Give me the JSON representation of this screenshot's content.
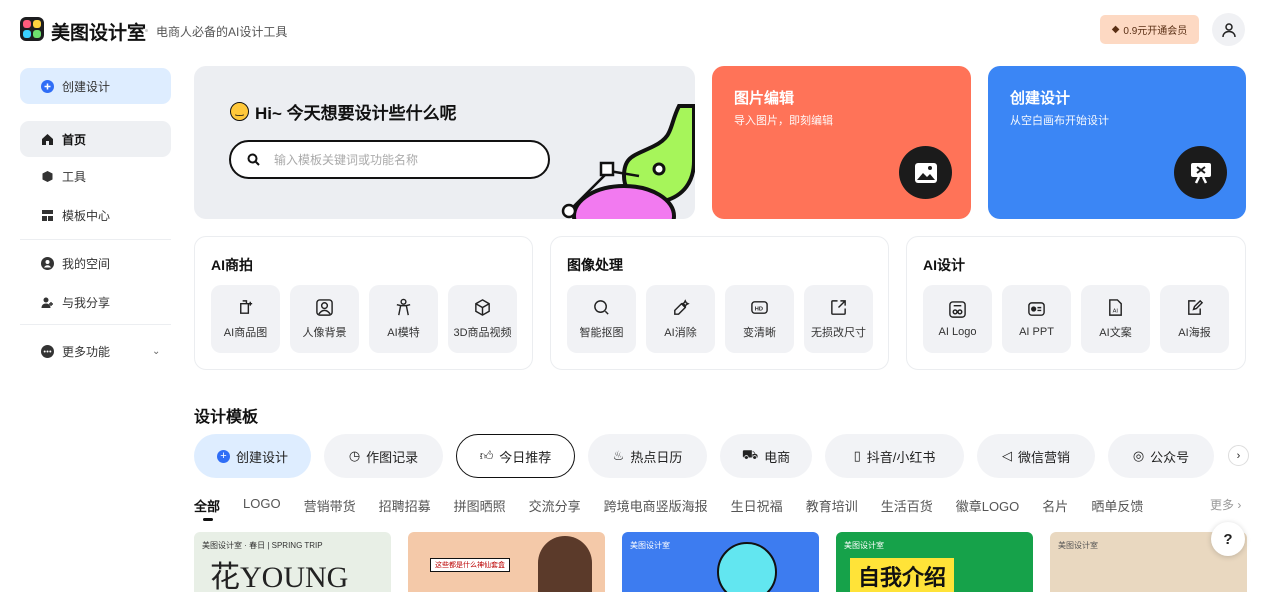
{
  "header": {
    "brand": "美图设计室",
    "slogan": "电商人必备的AI设计工具",
    "vip": "0.9元开通会员"
  },
  "sidebar": {
    "create": "创建设计",
    "items": [
      {
        "label": "首页"
      },
      {
        "label": "工具"
      },
      {
        "label": "模板中心"
      },
      {
        "label": "我的空间"
      },
      {
        "label": "与我分享"
      },
      {
        "label": "更多功能"
      }
    ]
  },
  "hero": {
    "greeting": "Hi~ 今天想要设计些什么呢",
    "placeholder": "输入模板关键词或功能名称"
  },
  "cards": [
    {
      "title": "图片编辑",
      "sub": "导入图片，即刻编辑",
      "color": "#ff7358"
    },
    {
      "title": "创建设计",
      "sub": "从空白画布开始设计",
      "color": "#3b86f5"
    }
  ],
  "groups": [
    {
      "title": "AI商拍",
      "tools": [
        "AI商品图",
        "人像背景",
        "AI模特",
        "3D商品视频"
      ]
    },
    {
      "title": "图像处理",
      "tools": [
        "智能抠图",
        "AI消除",
        "变清晰",
        "无损改尺寸"
      ]
    },
    {
      "title": "AI设计",
      "tools": [
        "AI Logo",
        "AI PPT",
        "AI文案",
        "AI海报"
      ]
    }
  ],
  "templates": {
    "title": "设计模板",
    "pills": [
      "创建设计",
      "作图记录",
      "今日推荐",
      "热点日历",
      "电商",
      "抖音/小红书",
      "微信营销",
      "公众号"
    ],
    "categories": [
      "全部",
      "LOGO",
      "营销带货",
      "招聘招募",
      "拼图晒照",
      "交流分享",
      "跨境电商竖版海报",
      "生日祝福",
      "教育培训",
      "生活百货",
      "徽章LOGO",
      "名片",
      "晒单反馈"
    ],
    "more": "更多",
    "thumbs": [
      {
        "label": "美图设计室 · 春日 | SPRING TRIP",
        "big": "花YOUNG",
        "bg": "#e8efe6"
      },
      {
        "label": "这些都是什么神仙套盒",
        "big": "",
        "bg": "#f4c9a9"
      },
      {
        "label": "美图设计室",
        "big": "",
        "bg": "#3d7cf0"
      },
      {
        "label": "美图设计室",
        "big": "自我介绍",
        "bg": "#16a24a"
      },
      {
        "label": "美图设计室",
        "big": "",
        "bg": "#e9d8c0"
      }
    ]
  },
  "help": "?"
}
